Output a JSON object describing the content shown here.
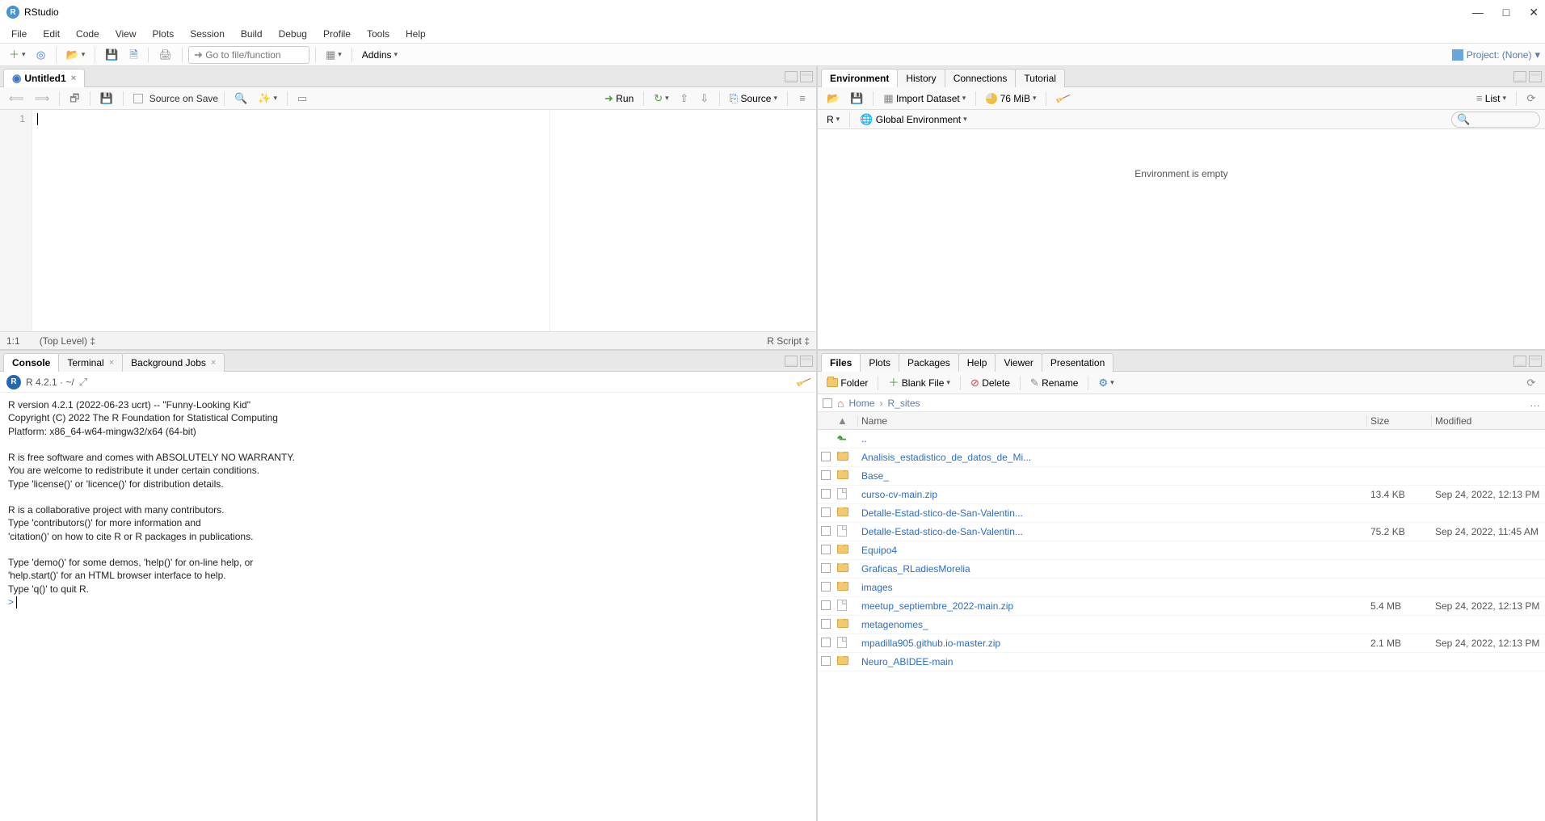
{
  "window": {
    "title": "RStudio"
  },
  "menubar": [
    "File",
    "Edit",
    "Code",
    "View",
    "Plots",
    "Session",
    "Build",
    "Debug",
    "Profile",
    "Tools",
    "Help"
  ],
  "toolbar": {
    "goto_placeholder": "Go to file/function",
    "addins_label": "Addins",
    "project_label": "Project: (None)"
  },
  "source": {
    "tab_title": "Untitled1",
    "source_on_save": "Source on Save",
    "run_label": "Run",
    "source_label": "Source",
    "gutter_line": "1",
    "status_pos": "1:1",
    "status_scope": "(Top Level)",
    "status_lang": "R Script"
  },
  "console": {
    "tab_console": "Console",
    "tab_terminal": "Terminal",
    "tab_jobs": "Background Jobs",
    "version_line": "R 4.2.1 · ~/",
    "output": "R version 4.2.1 (2022-06-23 ucrt) -- \"Funny-Looking Kid\"\nCopyright (C) 2022 The R Foundation for Statistical Computing\nPlatform: x86_64-w64-mingw32/x64 (64-bit)\n\nR is free software and comes with ABSOLUTELY NO WARRANTY.\nYou are welcome to redistribute it under certain conditions.\nType 'license()' or 'licence()' for distribution details.\n\nR is a collaborative project with many contributors.\nType 'contributors()' for more information and\n'citation()' on how to cite R or R packages in publications.\n\nType 'demo()' for some demos, 'help()' for on-line help, or\n'help.start()' for an HTML browser interface to help.\nType 'q()' to quit R.\n",
    "prompt": "> "
  },
  "env": {
    "tab_env": "Environment",
    "tab_hist": "History",
    "tab_conn": "Connections",
    "tab_tut": "Tutorial",
    "import_label": "Import Dataset",
    "mem_label": "76 MiB",
    "list_label": "List",
    "lang_label": "R",
    "scope_label": "Global Environment",
    "empty_msg": "Environment is empty"
  },
  "files": {
    "tab_files": "Files",
    "tab_plots": "Plots",
    "tab_pkgs": "Packages",
    "tab_help": "Help",
    "tab_viewer": "Viewer",
    "tab_pres": "Presentation",
    "btn_folder": "Folder",
    "btn_blank": "Blank File",
    "btn_delete": "Delete",
    "btn_rename": "Rename",
    "crumb_home": "Home",
    "crumb_dir": "R_sites",
    "col_name": "Name",
    "col_size": "Size",
    "col_mod": "Modified",
    "up_label": "..",
    "rows": [
      {
        "type": "folder",
        "name": "Analisis_estadistico_de_datos_de_Mi...",
        "size": "",
        "mod": ""
      },
      {
        "type": "folder",
        "name": "Base_",
        "size": "",
        "mod": ""
      },
      {
        "type": "file",
        "name": "curso-cv-main.zip",
        "size": "13.4 KB",
        "mod": "Sep 24, 2022, 12:13 PM"
      },
      {
        "type": "folder",
        "name": "Detalle-Estad-stico-de-San-Valentin...",
        "size": "",
        "mod": ""
      },
      {
        "type": "file",
        "name": "Detalle-Estad-stico-de-San-Valentin...",
        "size": "75.2 KB",
        "mod": "Sep 24, 2022, 11:45 AM"
      },
      {
        "type": "folder",
        "name": "Equipo4",
        "size": "",
        "mod": ""
      },
      {
        "type": "folder",
        "name": "Graficas_RLadiesMorelia",
        "size": "",
        "mod": ""
      },
      {
        "type": "folder",
        "name": "images",
        "size": "",
        "mod": ""
      },
      {
        "type": "file",
        "name": "meetup_septiembre_2022-main.zip",
        "size": "5.4 MB",
        "mod": "Sep 24, 2022, 12:13 PM"
      },
      {
        "type": "folder",
        "name": "metagenomes_",
        "size": "",
        "mod": ""
      },
      {
        "type": "file",
        "name": "mpadilla905.github.io-master.zip",
        "size": "2.1 MB",
        "mod": "Sep 24, 2022, 12:13 PM"
      },
      {
        "type": "folder",
        "name": "Neuro_ABIDEE-main",
        "size": "",
        "mod": ""
      }
    ]
  }
}
